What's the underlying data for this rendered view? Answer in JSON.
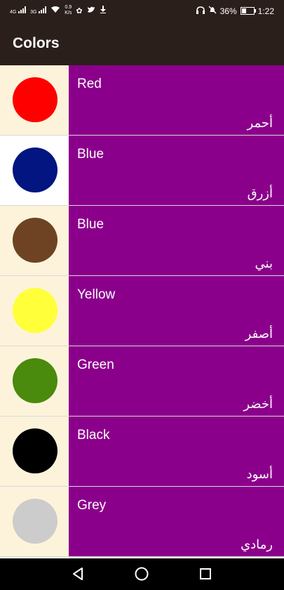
{
  "status_bar": {
    "net1": "4G",
    "net2": "3G",
    "speed_value": "0.9",
    "speed_unit": "K/s",
    "battery": "36%",
    "time": "1:22"
  },
  "app_bar": {
    "title": "Colors"
  },
  "colors": [
    {
      "english": "Red",
      "arabic": "أحمر",
      "swatch": "#ff0000",
      "bg": "#fdf3da"
    },
    {
      "english": "Blue",
      "arabic": "أزرق",
      "swatch": "#021580",
      "bg": "#ffffff"
    },
    {
      "english": "Blue",
      "arabic": "بني",
      "swatch": "#6e4323",
      "bg": "#fdf3da"
    },
    {
      "english": "Yellow",
      "arabic": "أصفر",
      "swatch": "#ffff3a",
      "bg": "#fdf3da"
    },
    {
      "english": "Green",
      "arabic": "أخضر",
      "swatch": "#4a8a0d",
      "bg": "#fdf3da"
    },
    {
      "english": "Black",
      "arabic": "أسود",
      "swatch": "#000000",
      "bg": "#fdf3da"
    },
    {
      "english": "Grey",
      "arabic": "رمادي",
      "swatch": "#cccccc",
      "bg": "#fdf3da"
    }
  ],
  "theme": {
    "app_bar": "#2b1f1c",
    "row_text_bg": "#8b008b"
  },
  "nav_bar": {
    "back": "back-icon",
    "home": "home-icon",
    "recent": "recent-apps-icon"
  }
}
